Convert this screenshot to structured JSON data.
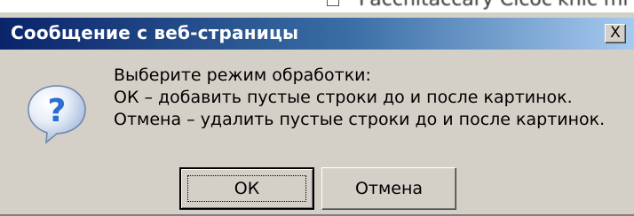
{
  "dialog": {
    "title": "Сообщение с веб-страницы",
    "close_symbol": "X",
    "icon": "question-icon",
    "message_lines": [
      "Выберите режим обработки:",
      "ОК – добавить пустые строки до и после картинок.",
      "Отмена – удалить пустые строки до и после картинок."
    ],
    "buttons": {
      "ok_label": "ОК",
      "cancel_label": "Отмена"
    }
  },
  "background_strip": {
    "partial_text": "Pacchitaccary Cicoc'knic mi"
  },
  "colors": {
    "window_face": "#d4d0c8",
    "title_gradient_start": "#0a246a",
    "title_gradient_end": "#a6caf0",
    "title_text": "#ffffff",
    "icon_blue": "#2b6fcf"
  }
}
